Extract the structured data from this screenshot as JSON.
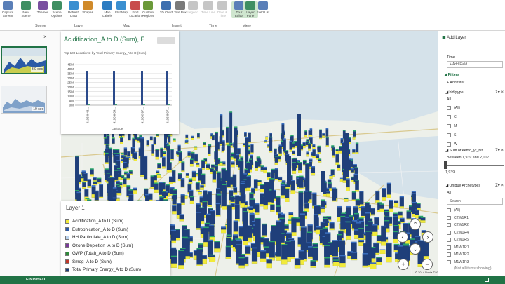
{
  "ribbon": {
    "buttons": [
      {
        "label": "Capture Screen",
        "state": "normal",
        "color": "#5a7fb8"
      },
      {
        "label": "New Scene",
        "state": "normal",
        "color": "#3f8f62"
      },
      {
        "label": "Themes",
        "state": "normal",
        "color": "#7a4fa0"
      },
      {
        "label": "Scene Options",
        "state": "normal",
        "color": "#3f8f62"
      },
      {
        "label": "Refresh Data",
        "state": "normal",
        "color": "#3a8fd0"
      },
      {
        "label": "Shapes",
        "state": "normal",
        "color": "#d08a2a"
      },
      {
        "label": "Map Labels",
        "state": "normal",
        "color": "#2c7cc2"
      },
      {
        "label": "Flat Map",
        "state": "normal",
        "color": "#3a8fd0"
      },
      {
        "label": "Find Location",
        "state": "normal",
        "color": "#c84c4c"
      },
      {
        "label": "Custom Regions",
        "state": "normal",
        "color": "#6b9a3a"
      },
      {
        "label": "2D Chart",
        "state": "normal",
        "color": "#3d6fb0"
      },
      {
        "label": "Text Box",
        "state": "normal",
        "color": "#7a7a7a"
      },
      {
        "label": "Legend",
        "state": "disabled",
        "color": "#c6c6c6"
      },
      {
        "label": "Time Line",
        "state": "disabled",
        "color": "#c6c6c6"
      },
      {
        "label": "Date & Time",
        "state": "disabled",
        "color": "#c6c6c6"
      },
      {
        "label": "Tour Editor",
        "state": "active",
        "color": "#5a7fb8"
      },
      {
        "label": "Layer Pane",
        "state": "active",
        "color": "#3f8f62"
      },
      {
        "label": "Field List",
        "state": "normal",
        "color": "#5a7fb8"
      }
    ],
    "groups": [
      "Scene",
      "Layer",
      "Map",
      "Insert",
      "Time",
      "View"
    ]
  },
  "scene_pane": {
    "close_glyph": "×",
    "scenes": [
      {
        "label": "3.0 sec"
      },
      {
        "label": "10 sec"
      }
    ]
  },
  "chart_panel": {
    "title": "Acidification_A to D (Sum), E...",
    "subtitle": "Top 100 Locations: by Total Primary Energy_A to D (Sum)",
    "x_axis_title": "Latitude"
  },
  "chart_data": {
    "type": "bar",
    "title": "Acidification_A to D (Sum), E...",
    "subtitle": "Top 100 Locations: by Total Primary Energy_A to D (Sum)",
    "xlabel": "Latitude",
    "ylabel": "",
    "categories": [
      "41969043...",
      "41969034...",
      "41968597...",
      "41968507..."
    ],
    "series": [
      {
        "name": "Total Primary Energy_A to D (Sum)",
        "color": "#2b4a8b",
        "values": [
          38000000,
          38000000,
          38000000,
          38000000
        ]
      },
      {
        "name": "Smog_A to D (Sum)",
        "color": "#2aa76a",
        "values": [
          1200000,
          1200000,
          1000000,
          1000000
        ]
      }
    ],
    "yticks": [
      "0M",
      "5M",
      "10M",
      "15M",
      "20M",
      "25M",
      "30M",
      "35M",
      "40M",
      "45M"
    ],
    "ylim": [
      0,
      45000000
    ],
    "grid": true
  },
  "legend": {
    "title": "Layer 1",
    "items": [
      {
        "label": "Acidification_A to D (Sum)",
        "color": "#f1ea3a"
      },
      {
        "label": "Eutrophication_A to D (Sum)",
        "color": "#2b5aa6"
      },
      {
        "label": "HH Particulate_A to D (Sum)",
        "color": "#bcd4ee"
      },
      {
        "label": "Ozone Depletion_A to D (Sum)",
        "color": "#7a3a9a"
      },
      {
        "label": "GWP (Total)_A to D (Sum)",
        "color": "#2e8b3a"
      },
      {
        "label": "Smog_A to D (Sum)",
        "color": "#c0392b"
      },
      {
        "label": "Total Primary Energy_A to D (Sum)",
        "color": "#1f3f7a"
      }
    ]
  },
  "map": {
    "copyright": "© 2014 Nokia  ©2014 Microsoft Corporation",
    "controls": {
      "up": "⌃",
      "left": "‹",
      "right": "›",
      "down": "⌄",
      "zoom_in": "+",
      "zoom_out": "−"
    }
  },
  "layer_pane": {
    "add_layer": "Add Layer",
    "time_label": "Time",
    "add_field": "Add Field",
    "filters_label": "Filters",
    "add_filter": "Add filter",
    "filter1": {
      "title": "bldgtype",
      "value": "All",
      "options": [
        "(All)",
        "C",
        "M",
        "S",
        "W"
      ]
    },
    "filter2": {
      "title": "Sum of eemd_yr_blt",
      "range_text": "Between 1,939 and 2,017",
      "min_value": "1,939"
    },
    "filter3": {
      "title": "Unique Archetypes",
      "value": "All",
      "search_placeholder": "Search",
      "options": [
        "(All)",
        "C2W1R1",
        "C2W1R2",
        "C2W1R4",
        "C2W1R5",
        "M1W1R1",
        "M1W1R2",
        "M1W1R3"
      ]
    },
    "footer": "(Not all items showing)",
    "icons": "Σ▾ ×"
  },
  "status": {
    "text": "FINISHED"
  },
  "colors": {
    "accent": "#217346",
    "bar_dark": "#1f3f7a",
    "bar_yellow": "#f1ea3a",
    "water": "#d5e2ea"
  }
}
